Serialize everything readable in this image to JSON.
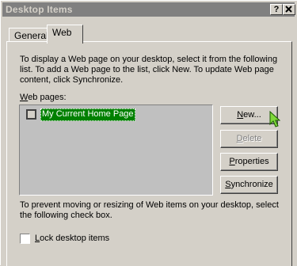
{
  "window": {
    "title": "Desktop Items",
    "help_button": "?",
    "close_button": "X"
  },
  "tabs": [
    {
      "label": "General",
      "selected": false
    },
    {
      "label": "Web",
      "selected": true
    }
  ],
  "web": {
    "intro_line1": "To display a Web page on your desktop, select it from the following",
    "intro_line2": "list. To add a Web page to the list, click New.  To update Web page",
    "intro_line3": "content, click Synchronize.",
    "list_label_key": "W",
    "list_label_rest": "eb pages:",
    "items": [
      {
        "label": "My Current Home Page",
        "checked": false,
        "selected": true
      }
    ],
    "buttons": {
      "new_key": "N",
      "new_rest": "ew...",
      "delete_key": "D",
      "delete_rest": "elete",
      "properties_key": "P",
      "properties_rest": "roperties",
      "sync_key": "S",
      "sync_rest": "ynchronize"
    },
    "lock_line1": "To prevent moving or resizing of Web items on your desktop, select",
    "lock_line2": "the following check box.",
    "lock_label_key": "L",
    "lock_label_rest": "ock desktop items",
    "lock_checked": false
  },
  "colors": {
    "face": "#d4d0c8",
    "selection": "#008000",
    "titlebar_inactive": "#808080"
  },
  "icons": {
    "cursor": "arrow-cursor-icon"
  }
}
